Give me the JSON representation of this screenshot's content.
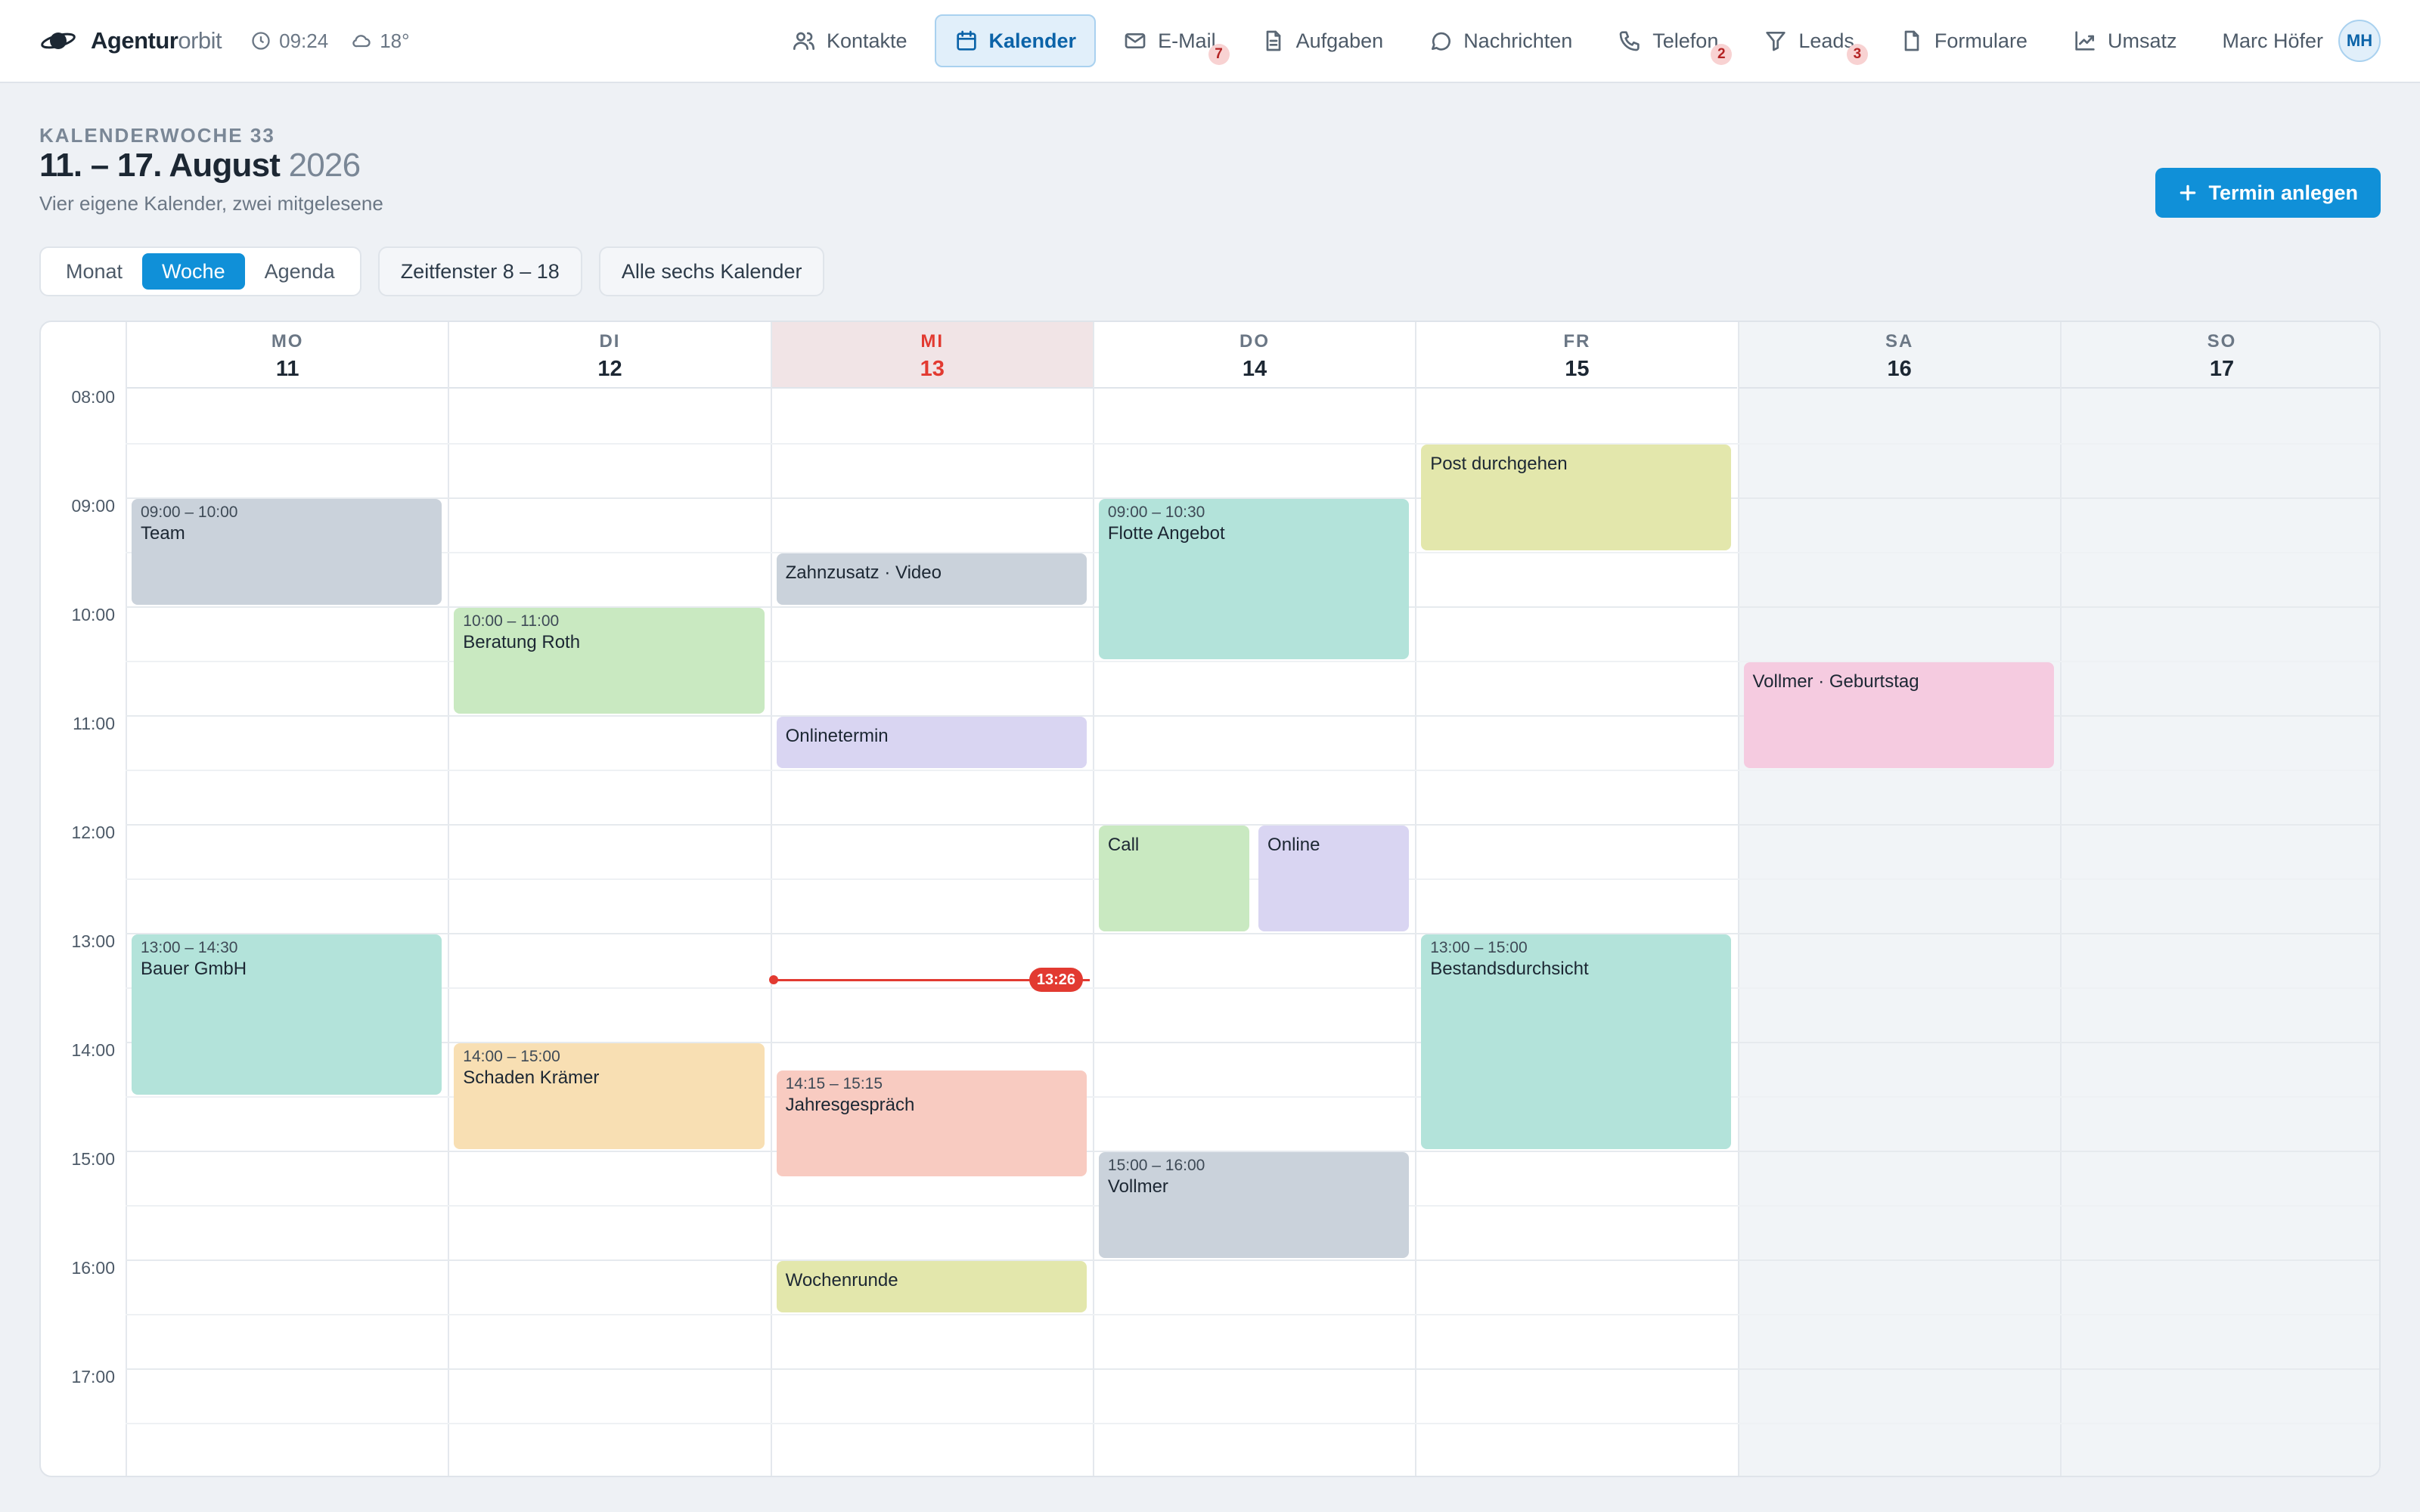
{
  "app": {
    "name_bold": "Agentur",
    "name_light": "orbit",
    "time": "09:24",
    "weather": "18°"
  },
  "nav": [
    {
      "label": "Kontakte",
      "icon": "users-icon",
      "active": false,
      "badge": null
    },
    {
      "label": "Kalender",
      "icon": "calendar-icon",
      "active": true,
      "badge": null
    },
    {
      "label": "E-Mail",
      "icon": "mail-icon",
      "active": false,
      "badge": "7"
    },
    {
      "label": "Aufgaben",
      "icon": "document-icon",
      "active": false,
      "badge": null
    },
    {
      "label": "Nachrichten",
      "icon": "chat-icon",
      "active": false,
      "badge": null
    },
    {
      "label": "Telefon",
      "icon": "phone-icon",
      "active": false,
      "badge": "2"
    },
    {
      "label": "Leads",
      "icon": "filter-icon",
      "active": false,
      "badge": "3"
    },
    {
      "label": "Formulare",
      "icon": "file-icon",
      "active": false,
      "badge": null
    },
    {
      "label": "Umsatz",
      "icon": "trend-icon",
      "active": false,
      "badge": null
    }
  ],
  "user": {
    "name": "Marc Höfer",
    "initials": "MH"
  },
  "header": {
    "week_label": "KALENDERWOCHE 33",
    "title": "11. – 17. August",
    "year": "2026",
    "subtitle": "Vier eigene Kalender, zwei mitgelesene",
    "create_button": "Termin anlegen"
  },
  "views": [
    {
      "label": "Monat",
      "active": false
    },
    {
      "label": "Woche",
      "active": true
    },
    {
      "label": "Agenda",
      "active": false
    }
  ],
  "filters": {
    "time_window": "Zeitfenster 8 – 18",
    "calendars": "Alle sechs Kalender"
  },
  "colors": {
    "gray": "#cad2db",
    "green": "#c9e9c1",
    "teal": "#b3e3da",
    "lavender": "#d9d5f2",
    "yellow": "#e3e7ac",
    "pink": "#f5cbe0",
    "peach": "#f8dfb3",
    "salmon": "#f8cbc1",
    "accent": "#1090d8",
    "now": "#e23a31"
  },
  "days": [
    {
      "dow": "MO",
      "num": "11",
      "today": false,
      "weekend": false
    },
    {
      "dow": "DI",
      "num": "12",
      "today": false,
      "weekend": false
    },
    {
      "dow": "MI",
      "num": "13",
      "today": true,
      "weekend": false
    },
    {
      "dow": "DO",
      "num": "14",
      "today": false,
      "weekend": false
    },
    {
      "dow": "FR",
      "num": "15",
      "today": false,
      "weekend": false
    },
    {
      "dow": "SA",
      "num": "16",
      "today": false,
      "weekend": true
    },
    {
      "dow": "SO",
      "num": "17",
      "today": false,
      "weekend": true
    }
  ],
  "hours": [
    "08:00",
    "09:00",
    "10:00",
    "11:00",
    "12:00",
    "13:00",
    "14:00",
    "15:00",
    "16:00",
    "17:00"
  ],
  "now_time": "13:26",
  "events": [
    {
      "day": 0,
      "start": 9.0,
      "end": 10.0,
      "time": "09:00 – 10:00",
      "title": "Team",
      "color": "gray",
      "lane": 0,
      "lanes": 1
    },
    {
      "day": 0,
      "start": 13.0,
      "end": 14.5,
      "time": "13:00 – 14:30",
      "title": "Bauer GmbH",
      "color": "teal",
      "lane": 0,
      "lanes": 1
    },
    {
      "day": 1,
      "start": 10.0,
      "end": 11.0,
      "time": "10:00 – 11:00",
      "title": "Beratung Roth",
      "color": "green",
      "lane": 0,
      "lanes": 1
    },
    {
      "day": 1,
      "start": 14.0,
      "end": 15.0,
      "time": "14:00 – 15:00",
      "title": "Schaden Krämer",
      "color": "peach",
      "lane": 0,
      "lanes": 1
    },
    {
      "day": 2,
      "start": 9.5,
      "end": 10.0,
      "time": "",
      "title": "Zahnzusatz · Video",
      "color": "gray",
      "lane": 0,
      "lanes": 1
    },
    {
      "day": 2,
      "start": 11.0,
      "end": 11.5,
      "time": "",
      "title": "Onlinetermin",
      "color": "lavender",
      "lane": 0,
      "lanes": 1
    },
    {
      "day": 2,
      "start": 14.25,
      "end": 15.25,
      "time": "14:15 – 15:15",
      "title": "Jahresgespräch",
      "color": "salmon",
      "lane": 0,
      "lanes": 1
    },
    {
      "day": 2,
      "start": 16.0,
      "end": 16.5,
      "time": "",
      "title": "Wochenrunde",
      "color": "yellow",
      "lane": 0,
      "lanes": 1
    },
    {
      "day": 3,
      "start": 9.0,
      "end": 10.5,
      "time": "09:00 – 10:30",
      "title": "Flotte Angebot",
      "color": "teal",
      "lane": 0,
      "lanes": 1
    },
    {
      "day": 3,
      "start": 12.0,
      "end": 13.0,
      "time": "",
      "title": "Call",
      "color": "green",
      "lane": 0,
      "lanes": 2
    },
    {
      "day": 3,
      "start": 12.0,
      "end": 13.0,
      "time": "",
      "title": "Online",
      "color": "lavender",
      "lane": 1,
      "lanes": 2
    },
    {
      "day": 3,
      "start": 15.0,
      "end": 16.0,
      "time": "15:00 – 16:00",
      "title": "Vollmer",
      "color": "gray",
      "lane": 0,
      "lanes": 1
    },
    {
      "day": 4,
      "start": 8.5,
      "end": 9.5,
      "time": "",
      "title": "Post durchgehen",
      "color": "yellow",
      "lane": 0,
      "lanes": 1
    },
    {
      "day": 4,
      "start": 13.0,
      "end": 15.0,
      "time": "13:00 – 15:00",
      "title": "Bestandsdurchsicht",
      "color": "teal",
      "lane": 0,
      "lanes": 1
    },
    {
      "day": 5,
      "start": 10.5,
      "end": 11.5,
      "time": "",
      "title": "Vollmer · Geburtstag",
      "color": "pink",
      "lane": 0,
      "lanes": 1
    }
  ]
}
